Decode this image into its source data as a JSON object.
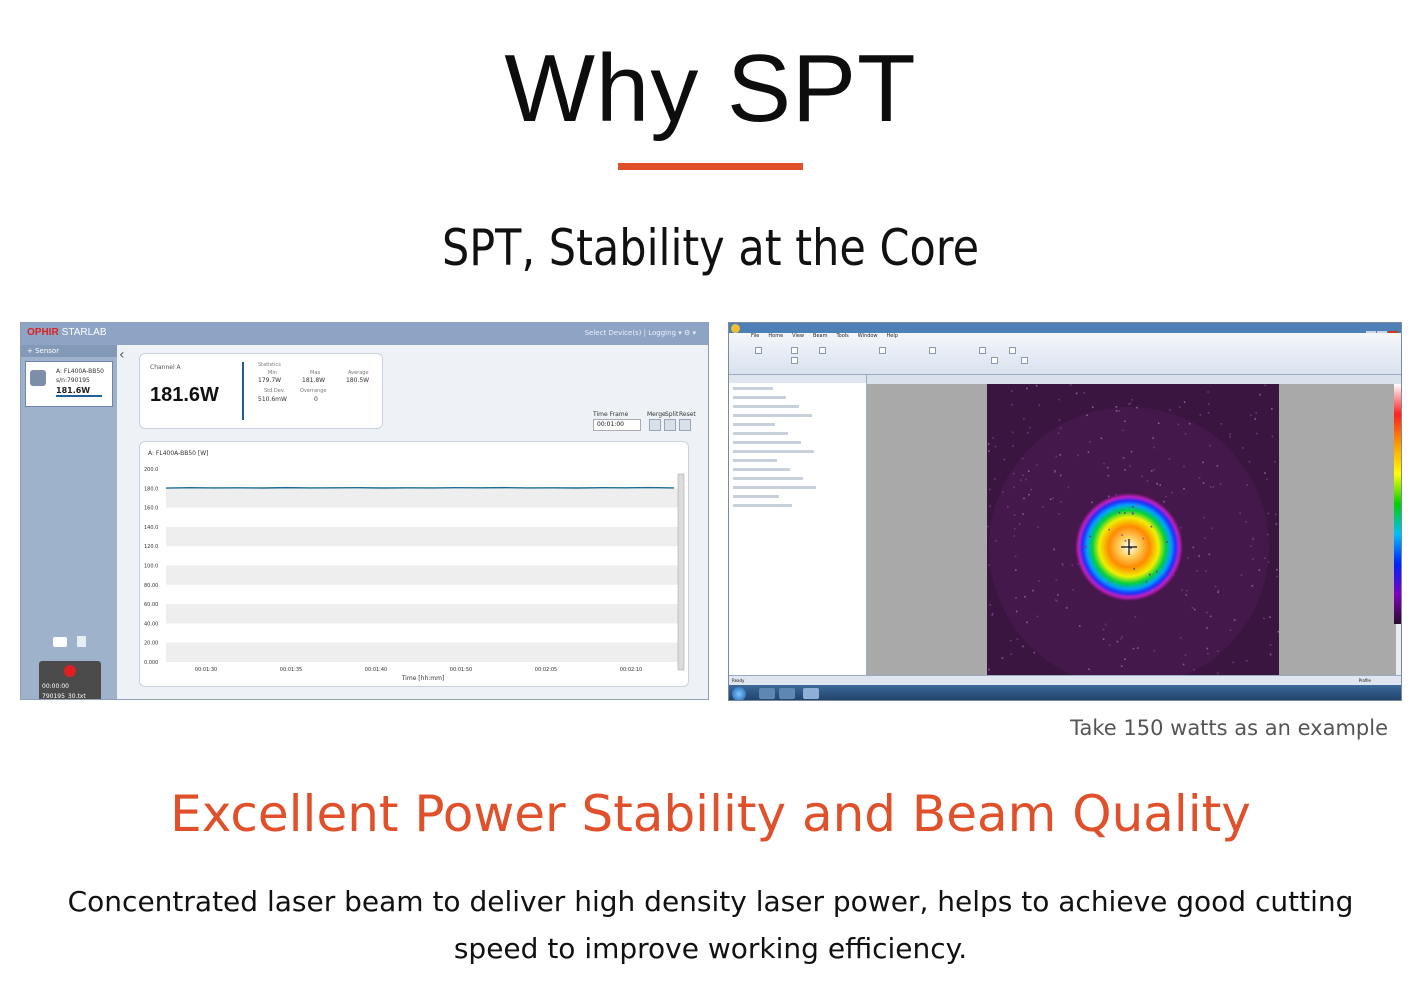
{
  "header": {
    "title": "Why SPT",
    "subtitle": "SPT, Stability at the Core"
  },
  "power_meter": {
    "logo": "OPHIR",
    "logo_sub": "STARLAB",
    "menu": "Select Device(s)  |  Logging ▾   ⚙ ▾",
    "sidebar_label": "+ Sensor",
    "device_name": "A: FL400A-BB50",
    "device_sn": "s/n:790195",
    "device_value": "181.6W",
    "channel_label": "Channel A",
    "big_value": "181.6W",
    "stats": {
      "stats_label": "Statistics",
      "min_label": "Min",
      "min_value": "179.7W",
      "max_label": "Max",
      "max_value": "181.8W",
      "avg_label": "Average",
      "avg_value": "180.5W",
      "std_label": "Std.Dev.",
      "std_value": "510.6mW",
      "overrange_label": "Overrange",
      "overrange_value": "0"
    },
    "time_frame_label": "Time Frame",
    "time_frame_value": "00:01:00",
    "merge_label": "Merge",
    "split_label": "Split",
    "reset_label": "Reset",
    "chart_title": "A: FL400A-BB50 [W]",
    "rec_time": "00:00:00",
    "rec_file": "790195_30.txt"
  },
  "chart_data": {
    "type": "line",
    "title": "A: FL400A-BB50 [W]",
    "xlabel": "Time [hh:mm]",
    "ylabel": "",
    "ylim": [
      0,
      200
    ],
    "y_ticks": [
      "200.0",
      "180.0",
      "160.0",
      "140.0",
      "120.0",
      "100.0",
      "80.00",
      "60.00",
      "40.00",
      "20.00",
      "0.000"
    ],
    "x_ticks": [
      "00:01:30",
      "00:01:35",
      "00:01:40",
      "00:01:50",
      "00:02:05",
      "00:02:10"
    ],
    "series": [
      {
        "values": [
          180.2,
          180.6,
          180.4,
          180.5,
          180.3,
          180.7,
          180.4,
          180.5,
          180.6,
          180.3,
          180.5,
          180.4,
          180.6,
          180.5,
          180.7,
          180.4,
          180.5,
          180.3,
          180.6,
          180.5,
          180.8,
          180.4
        ]
      }
    ],
    "color": "#1f6e96"
  },
  "beam_profiler": {
    "ribbon_tabs": [
      "File",
      "Home",
      "View",
      "Beam",
      "Tools",
      "Window",
      "Help"
    ],
    "status_left": "Ready",
    "status_right": "Profile"
  },
  "caption": "Take 150 watts as an example",
  "section": {
    "heading": "Excellent Power Stability and Beam Quality",
    "body": "Concentrated laser beam to deliver high density laser power, helps to achieve good cutting speed to improve working efficiency."
  },
  "colors": {
    "accent": "#e0502a",
    "chart_line": "#1f6e96"
  }
}
